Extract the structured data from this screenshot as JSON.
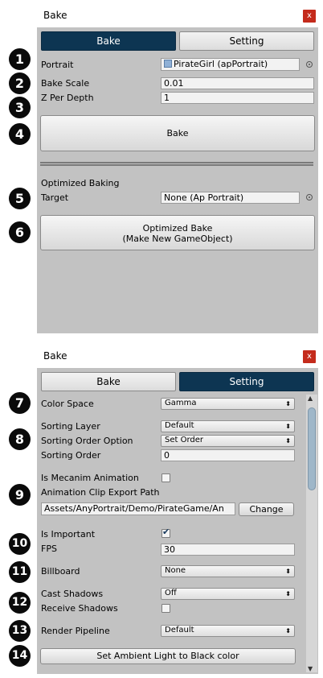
{
  "window1": {
    "title": "Bake",
    "close_label": "x",
    "tabs": {
      "bake": "Bake",
      "setting": "Setting"
    },
    "portrait": {
      "label": "Portrait",
      "value": "PirateGirl (apPortrait)"
    },
    "bake_scale": {
      "label": "Bake Scale",
      "value": "0.01"
    },
    "z_per_depth": {
      "label": "Z Per Depth",
      "value": "1"
    },
    "bake_button": "Bake",
    "optimized_header": "Optimized Baking",
    "target": {
      "label": "Target",
      "value": "None (Ap Portrait)"
    },
    "optimized_button_line1": "Optimized Bake",
    "optimized_button_line2": "(Make New GameObject)"
  },
  "window2": {
    "title": "Bake",
    "close_label": "x",
    "tabs": {
      "bake": "Bake",
      "setting": "Setting"
    },
    "color_space": {
      "label": "Color Space",
      "value": "Gamma"
    },
    "sorting_layer": {
      "label": "Sorting Layer",
      "value": "Default"
    },
    "sorting_order_option": {
      "label": "Sorting Order Option",
      "value": "Set Order"
    },
    "sorting_order": {
      "label": "Sorting Order",
      "value": "0"
    },
    "mecanim": {
      "label": "Is Mecanim Animation",
      "checked": false
    },
    "clip_path": {
      "label": "Animation Clip Export Path",
      "value": "Assets/AnyPortrait/Demo/PirateGame/An",
      "change_button": "Change"
    },
    "is_important": {
      "label": "Is Important",
      "checked": true,
      "check_glyph": "✔"
    },
    "fps": {
      "label": "FPS",
      "value": "30"
    },
    "billboard": {
      "label": "Billboard",
      "value": "None"
    },
    "cast_shadows": {
      "label": "Cast Shadows",
      "value": "Off"
    },
    "receive_shadows": {
      "label": "Receive Shadows",
      "checked": false
    },
    "render_pipeline": {
      "label": "Render Pipeline",
      "value": "Default"
    },
    "ambient_button": "Set Ambient Light to Black color"
  },
  "badges": [
    "1",
    "2",
    "3",
    "4",
    "5",
    "6",
    "7",
    "8",
    "9",
    "10",
    "11",
    "12",
    "13",
    "14"
  ],
  "icons": {
    "dropdown": "⬍",
    "scroll_up": "▲",
    "scroll_down": "▼",
    "object_field": "circle-target-icon",
    "asset": "portrait-asset-icon"
  },
  "colors": {
    "active_tab": "#0d3552",
    "panel_bg": "#c2c2c2",
    "close": "#c42b1c"
  }
}
